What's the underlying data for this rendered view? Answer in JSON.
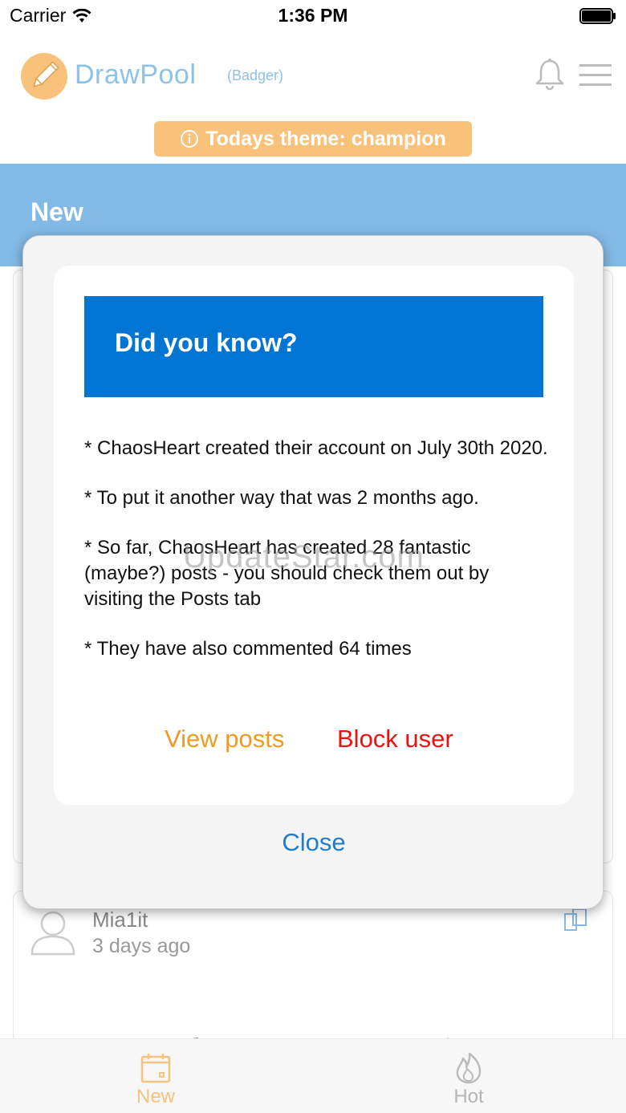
{
  "status_bar": {
    "carrier": "Carrier",
    "time": "1:36 PM"
  },
  "header": {
    "app_name": "DrawPool",
    "username": "(Badger)"
  },
  "theme_badge": {
    "text": "Todays theme: champion"
  },
  "section": {
    "title": "New"
  },
  "post": {
    "user": "Mia1it",
    "time": "3 days ago"
  },
  "modal": {
    "title": "Did you know?",
    "lines": [
      "* ChaosHeart created their account on July 30th 2020.",
      "* To put it another way that was 2 months ago.",
      "* So far, ChaosHeart has created 28 fantastic (maybe?) posts - you should check them out by visiting the Posts tab",
      "* They have also commented 64 times"
    ],
    "view_posts": "View posts",
    "block_user": "Block user",
    "close": "Close"
  },
  "watermark": "UpdateStar.com",
  "tabs": [
    {
      "label": "New",
      "icon": "calendar-icon"
    },
    {
      "label": "Hot",
      "icon": "flame-icon"
    }
  ],
  "colors": {
    "accent_orange": "#f9c27a",
    "band_blue": "#82b9e5",
    "banner_blue": "#0274d2",
    "view_orange": "#f29a1f",
    "block_red": "#ee1111",
    "close_blue": "#1f7dcb"
  }
}
